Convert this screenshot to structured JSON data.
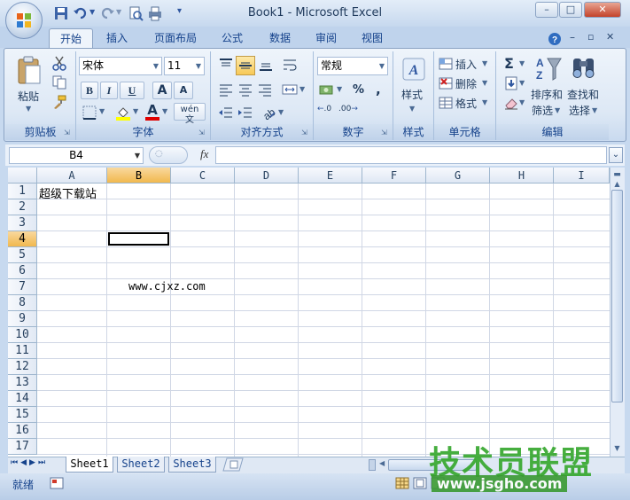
{
  "window": {
    "title": "Book1 - Microsoft Excel",
    "minimize": "–",
    "maximize": "□",
    "close": "✕"
  },
  "ribbon_tabs": [
    "开始",
    "插入",
    "页面布局",
    "公式",
    "数据",
    "审阅",
    "视图"
  ],
  "ribbon_groups": {
    "clipboard": {
      "label": "剪贴板",
      "paste": "粘贴"
    },
    "font": {
      "label": "字体",
      "font_name": "宋体",
      "font_size": "11",
      "bold": "B",
      "italic": "I",
      "underline": "U",
      "grow": "A",
      "shrink": "A",
      "color_a": "A",
      "phonetic": "wén"
    },
    "alignment": {
      "label": "对齐方式"
    },
    "number": {
      "label": "数字",
      "format": "常规",
      "percent": "%",
      "comma": ",",
      "inc_decimal": ".0",
      "dec_decimal": ".00"
    },
    "styles": {
      "label": "样式"
    },
    "cells": {
      "label": "单元格",
      "insert": "插入",
      "delete": "删除",
      "format": "格式"
    },
    "editing": {
      "label": "编辑",
      "sort_filter_1": "排序和",
      "sort_filter_2": "筛选",
      "find_1": "查找和",
      "find_2": "选择",
      "sigma": "Σ"
    }
  },
  "formula_bar": {
    "name_box": "B4",
    "fx": "fx",
    "formula": ""
  },
  "columns": [
    "A",
    "B",
    "C",
    "D",
    "E",
    "F",
    "G",
    "H",
    "I"
  ],
  "rows": [
    "1",
    "2",
    "3",
    "4",
    "5",
    "6",
    "7",
    "8",
    "9",
    "10",
    "11",
    "12",
    "13",
    "14",
    "15",
    "16",
    "17"
  ],
  "active_cell": "B4",
  "cells": {
    "A1": "超级下载站",
    "B7": "www.cjxz.com"
  },
  "sheets": [
    "Sheet1",
    "Sheet2",
    "Sheet3"
  ],
  "active_sheet": "Sheet1",
  "status": {
    "ready": "就绪"
  },
  "watermark": {
    "line1": "技术员联盟",
    "line2": "www.jsgho.com"
  },
  "colors": {
    "accent": "#15428b",
    "active_header": "#f1b84e",
    "watermark": "#37a82f"
  }
}
